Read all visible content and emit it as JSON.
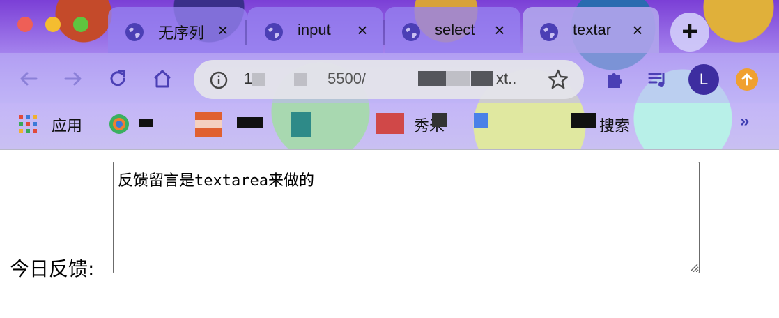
{
  "browser": {
    "tabs": [
      {
        "title": "无序列",
        "active": false
      },
      {
        "title": "input",
        "active": false
      },
      {
        "title": "select",
        "active": false
      },
      {
        "title": "textar",
        "active": true
      }
    ],
    "tab_close_glyph": "×",
    "new_tab_glyph": "+",
    "address_bar": {
      "url_visible_start": "12",
      "url_visible_mid": "5500/",
      "url_visible_end": "xt.."
    },
    "profile_initial": "L",
    "bookmarks": {
      "apps_label": "应用",
      "items": [
        {
          "label": "秀米"
        },
        {
          "label": "搜索"
        }
      ],
      "more_glyph": "»"
    },
    "colors": {
      "accent": "#4b3fb5",
      "avatar_bg": "#3d2da0",
      "update_badge": "#f0a030"
    },
    "icons": {
      "back": "arrow-left-icon",
      "forward": "arrow-right-icon",
      "reload": "reload-icon",
      "home": "home-icon",
      "site_info": "info-icon",
      "bookmark_star": "star-icon",
      "extensions": "puzzle-icon",
      "media": "playlist-icon",
      "update": "arrow-up-icon"
    }
  },
  "page": {
    "feedback_label": "今日反馈:",
    "feedback_textarea_value": "反馈留言是textarea来做的"
  }
}
